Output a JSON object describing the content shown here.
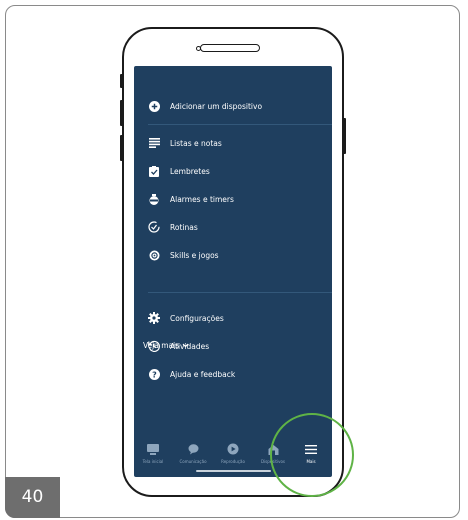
{
  "page_number": "40",
  "menu": {
    "add_device": "Adicionar um dispositivo",
    "items": [
      {
        "label": "Listas e notas",
        "icon": "list-icon"
      },
      {
        "label": "Lembretes",
        "icon": "reminder-icon"
      },
      {
        "label": "Alarmes e timers",
        "icon": "alarm-icon"
      },
      {
        "label": "Rotinas",
        "icon": "routines-icon"
      },
      {
        "label": "Skills e jogos",
        "icon": "skills-icon"
      }
    ],
    "see_more": "Veja mais",
    "settings_items": [
      {
        "label": "Configurações",
        "icon": "gear-icon"
      },
      {
        "label": "Atividades",
        "icon": "history-icon"
      },
      {
        "label": "Ajuda e feedback",
        "icon": "help-icon"
      }
    ]
  },
  "bottom_nav": [
    {
      "label": "Tela inicial",
      "icon": "home-icon",
      "active": false
    },
    {
      "label": "Comunicação",
      "icon": "chat-icon",
      "active": false
    },
    {
      "label": "Reprodução",
      "icon": "play-icon",
      "active": false
    },
    {
      "label": "Dispositivos",
      "icon": "devices-icon",
      "active": false
    },
    {
      "label": "Mais",
      "icon": "menu-icon",
      "active": true
    }
  ],
  "colors": {
    "screen_bg": "#1f3f5f",
    "highlight_ring": "#5fb346",
    "page_tab": "#6e6e6e"
  }
}
